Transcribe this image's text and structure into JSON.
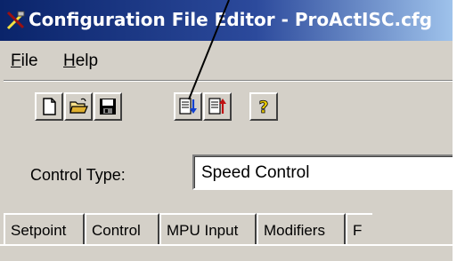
{
  "window": {
    "title": "Configuration File Editor - ProActISC.cfg",
    "title_icon": "tools-icon"
  },
  "menu": {
    "file_first": "F",
    "file_rest": "ile",
    "help_first": "H",
    "help_rest": "elp"
  },
  "toolbar": {
    "buttons": [
      {
        "name": "new-file-button",
        "icon": "new-document-icon"
      },
      {
        "name": "open-file-button",
        "icon": "open-folder-icon"
      },
      {
        "name": "save-file-button",
        "icon": "save-disk-icon"
      },
      {
        "name": "import-button",
        "icon": "document-arrow-down-icon"
      },
      {
        "name": "export-button",
        "icon": "document-arrow-up-icon"
      },
      {
        "name": "help-button",
        "icon": "question-mark-icon"
      }
    ]
  },
  "form": {
    "control_type_label": "Control Type:",
    "control_type_value": "Speed Control"
  },
  "tabs": [
    "Setpoint",
    "Control",
    "MPU Input",
    "Modifiers",
    "F"
  ],
  "colors": {
    "titlebar_start": "#0a246a",
    "titlebar_end": "#a6caf0",
    "face": "#d4d0c8"
  }
}
